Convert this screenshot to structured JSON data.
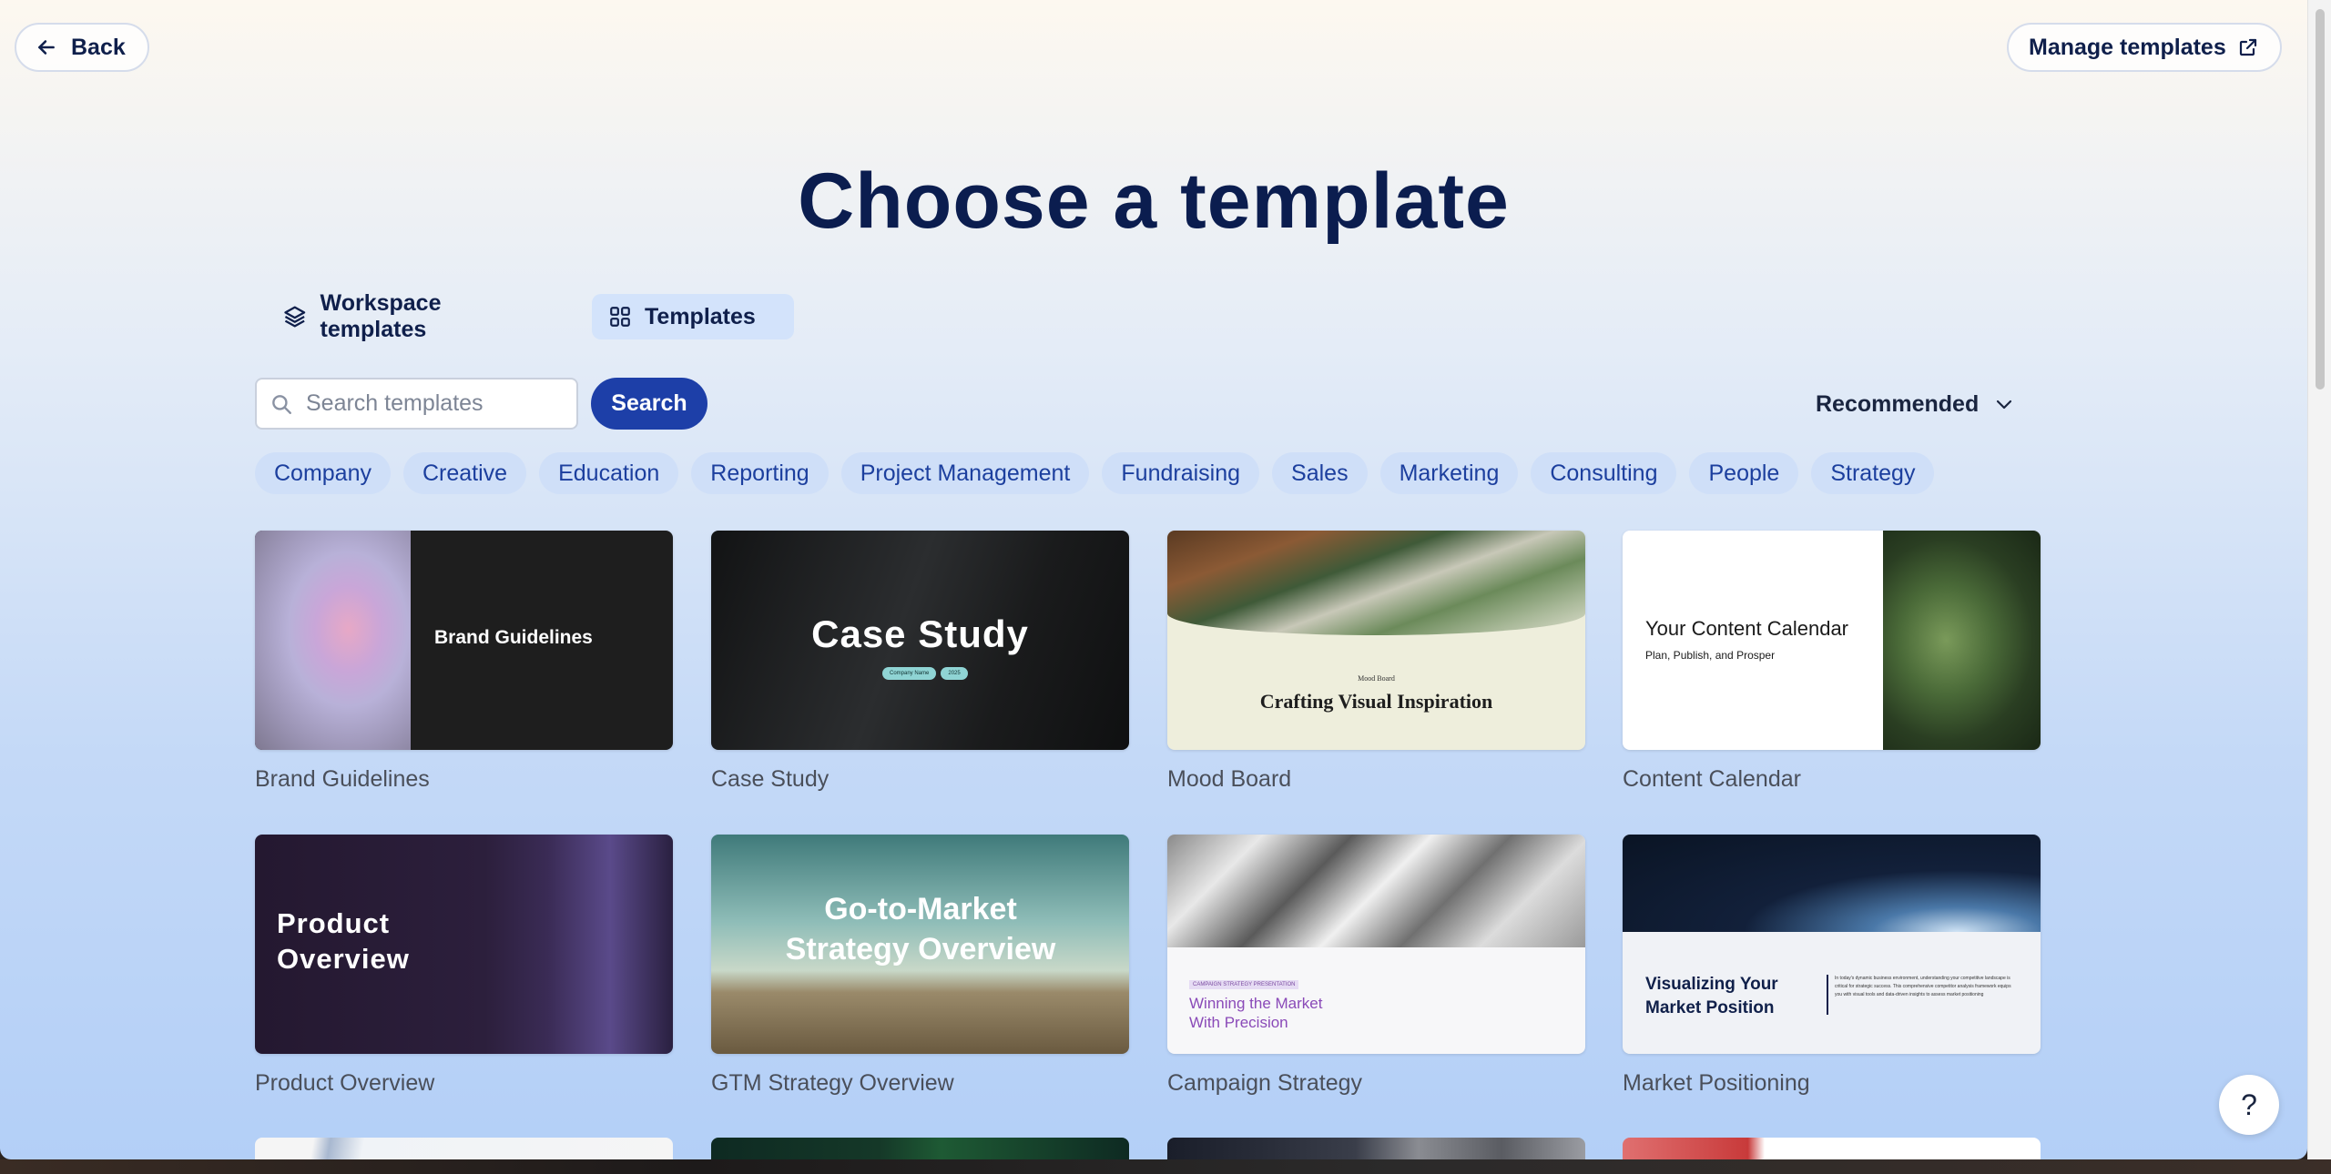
{
  "header": {
    "back_label": "Back",
    "manage_label": "Manage templates"
  },
  "title": "Choose a template",
  "tabs": [
    {
      "label": "Workspace templates",
      "icon": "layers-icon",
      "selected": false
    },
    {
      "label": "Templates",
      "icon": "grid-icon",
      "selected": true
    }
  ],
  "search": {
    "placeholder": "Search templates",
    "value": "",
    "button_label": "Search"
  },
  "sort": {
    "selected": "Recommended"
  },
  "categories": [
    "Company",
    "Creative",
    "Education",
    "Reporting",
    "Project Management",
    "Fundraising",
    "Sales",
    "Marketing",
    "Consulting",
    "People",
    "Strategy"
  ],
  "templates": [
    {
      "name": "Brand Guidelines",
      "thumb_text": "Brand Guidelines"
    },
    {
      "name": "Case Study",
      "thumb_text": "Case Study",
      "thumb_tags": [
        "Company Name",
        "2025"
      ]
    },
    {
      "name": "Mood Board",
      "thumb_kicker": "Mood Board",
      "thumb_text": "Crafting Visual Inspiration"
    },
    {
      "name": "Content Calendar",
      "thumb_text": "Your Content Calendar",
      "thumb_sub": "Plan, Publish, and Prosper"
    },
    {
      "name": "Product Overview",
      "thumb_text": "Product Overview"
    },
    {
      "name": "GTM Strategy Overview",
      "thumb_text": "Go-to-Market Strategy Overview"
    },
    {
      "name": "Campaign Strategy",
      "thumb_kicker": "CAMPAIGN STRATEGY PRESENTATION",
      "thumb_text": "Winning the Market With Precision"
    },
    {
      "name": "Market Positioning",
      "thumb_text": "Visualizing Your Market Position",
      "thumb_sub": "In today's dynamic business environment, understanding your competitive landscape is critical for strategic success. This comprehensive competitor analysis framework equips you with visual tools and data-driven insights to assess market positioning"
    }
  ],
  "help_label": "?",
  "colors": {
    "primary": "#1d3fa8",
    "title": "#0b1d4f",
    "chip_bg": "#cfdff8",
    "chip_text": "#1c3f9e"
  }
}
